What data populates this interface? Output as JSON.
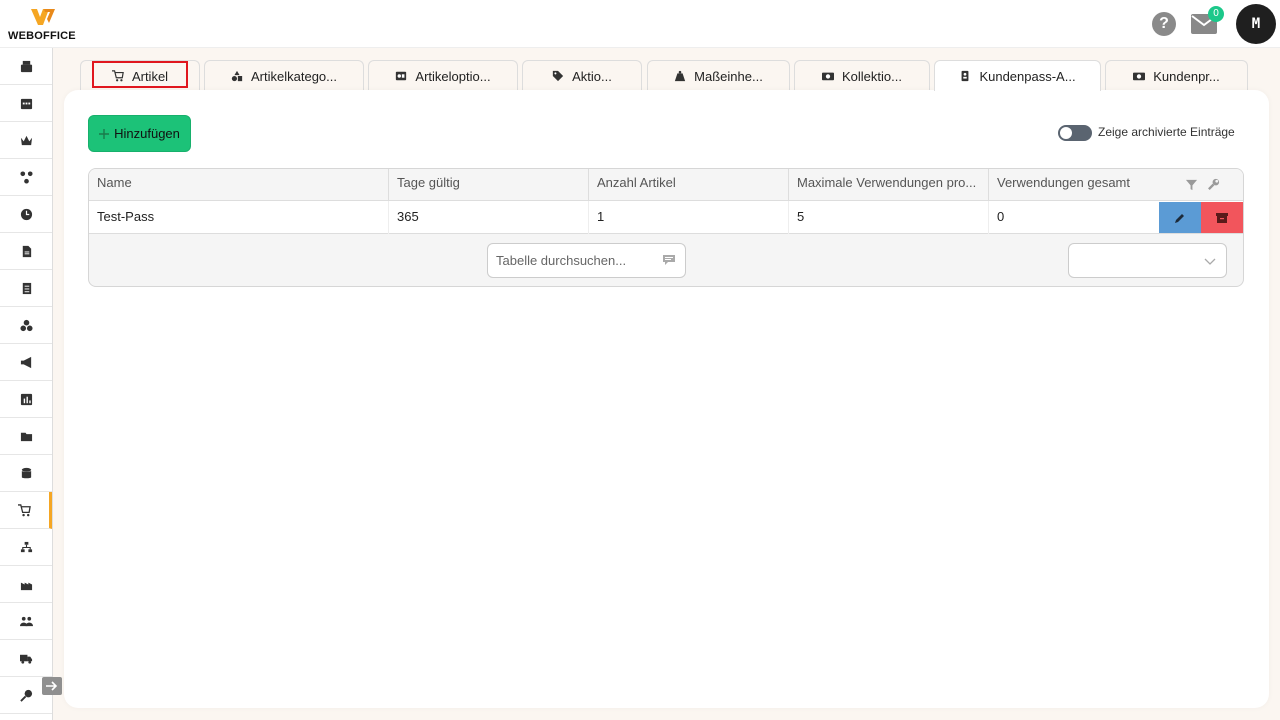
{
  "header": {
    "brand": "WEBOFFICE",
    "help_label": "?",
    "mail_count": "0",
    "user_initial": "M"
  },
  "sidebar": {
    "items": [
      {
        "icon": "cash-register-icon"
      },
      {
        "icon": "calendar-icon"
      },
      {
        "icon": "crown-icon"
      },
      {
        "icon": "network-icon"
      },
      {
        "icon": "clock-icon"
      },
      {
        "icon": "document-icon"
      },
      {
        "icon": "list-document-icon"
      },
      {
        "icon": "boxes-icon"
      },
      {
        "icon": "megaphone-icon"
      },
      {
        "icon": "bar-chart-icon"
      },
      {
        "icon": "folder-icon"
      },
      {
        "icon": "database-icon"
      },
      {
        "icon": "cart-icon",
        "active": true
      },
      {
        "icon": "hierarchy-icon"
      },
      {
        "icon": "factory-icon"
      },
      {
        "icon": "users-icon"
      },
      {
        "icon": "truck-icon"
      },
      {
        "icon": "key-icon"
      }
    ]
  },
  "tabs": [
    {
      "label": "Artikel",
      "icon": "cart-icon"
    },
    {
      "label": "Artikelkatego...",
      "icon": "shapes-icon"
    },
    {
      "label": "Artikeloptio...",
      "icon": "options-icon"
    },
    {
      "label": "Aktio...",
      "icon": "tag-icon"
    },
    {
      "label": "Maßeinhe...",
      "icon": "weight-icon"
    },
    {
      "label": "Kollektio...",
      "icon": "collection-icon"
    },
    {
      "label": "Kundenpass-A...",
      "icon": "id-card-icon"
    },
    {
      "label": "Kundenpr...",
      "icon": "money-icon"
    }
  ],
  "toolbar": {
    "add_label": "Hinzufügen",
    "archive_toggle_label": "Zeige archivierte Einträge"
  },
  "table": {
    "columns": [
      "Name",
      "Tage gültig",
      "Anzahl Artikel",
      "Maximale Verwendungen pro...",
      "Verwendungen gesamt"
    ],
    "rows": [
      [
        "Test-Pass",
        "365",
        "1",
        "5",
        "0"
      ]
    ],
    "search_placeholder": "Tabelle durchsuchen...",
    "page_size_value": ""
  }
}
